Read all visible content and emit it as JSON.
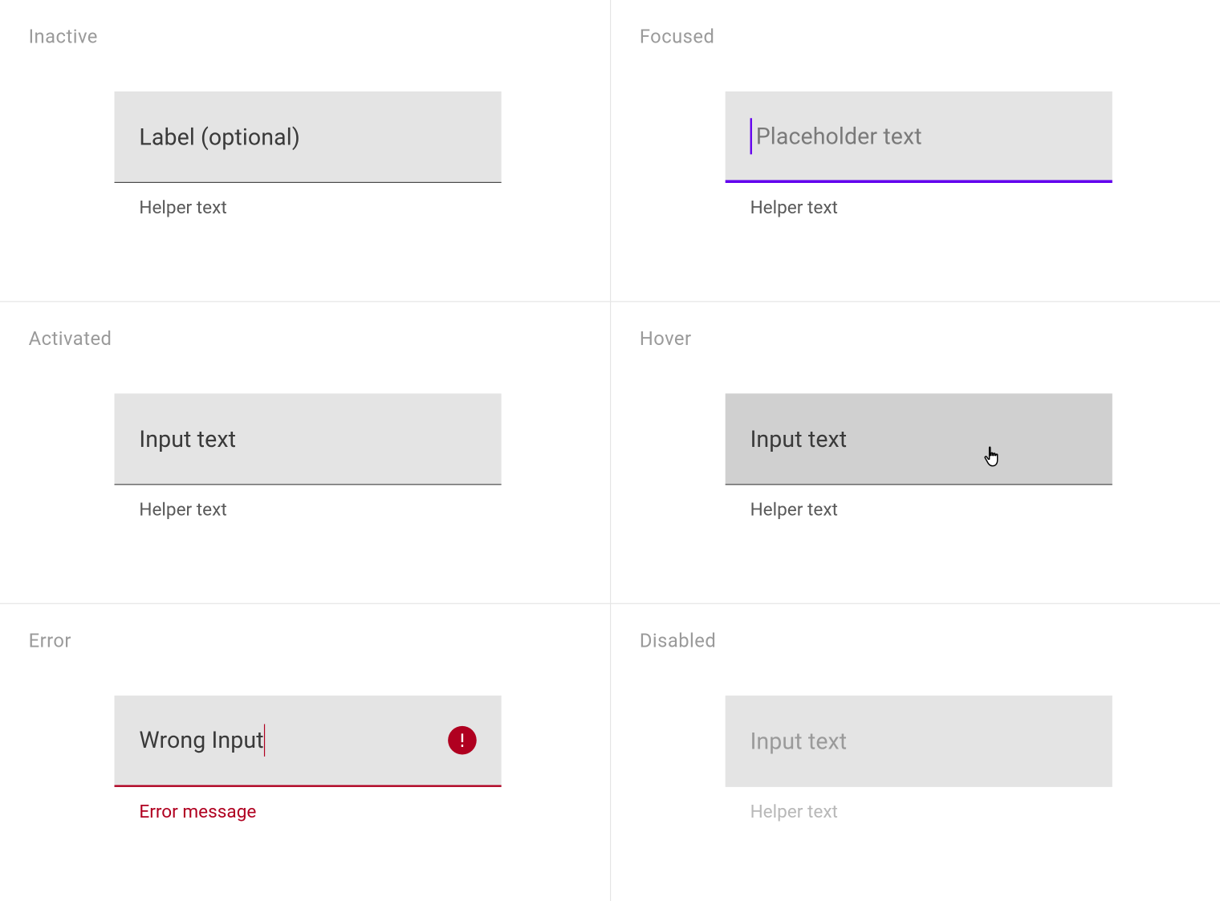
{
  "states": {
    "inactive": {
      "title": "Inactive",
      "input_text": "Label (optional)",
      "helper": "Helper text"
    },
    "focused": {
      "title": "Focused",
      "placeholder": "Placeholder text",
      "helper": "Helper text"
    },
    "activated": {
      "title": "Activated",
      "input_text": "Input text",
      "helper": "Helper text"
    },
    "hover": {
      "title": "Hover",
      "input_text": "Input text",
      "helper": "Helper text"
    },
    "error": {
      "title": "Error",
      "input_text": "Wrong Input",
      "helper": "Error message"
    },
    "disabled": {
      "title": "Disabled",
      "input_text": "Input text",
      "helper": "Helper text"
    }
  },
  "colors": {
    "accent": "#6200ee",
    "error": "#b00020",
    "field_bg": "#e4e4e4",
    "field_bg_hover": "#d0d0d0"
  }
}
